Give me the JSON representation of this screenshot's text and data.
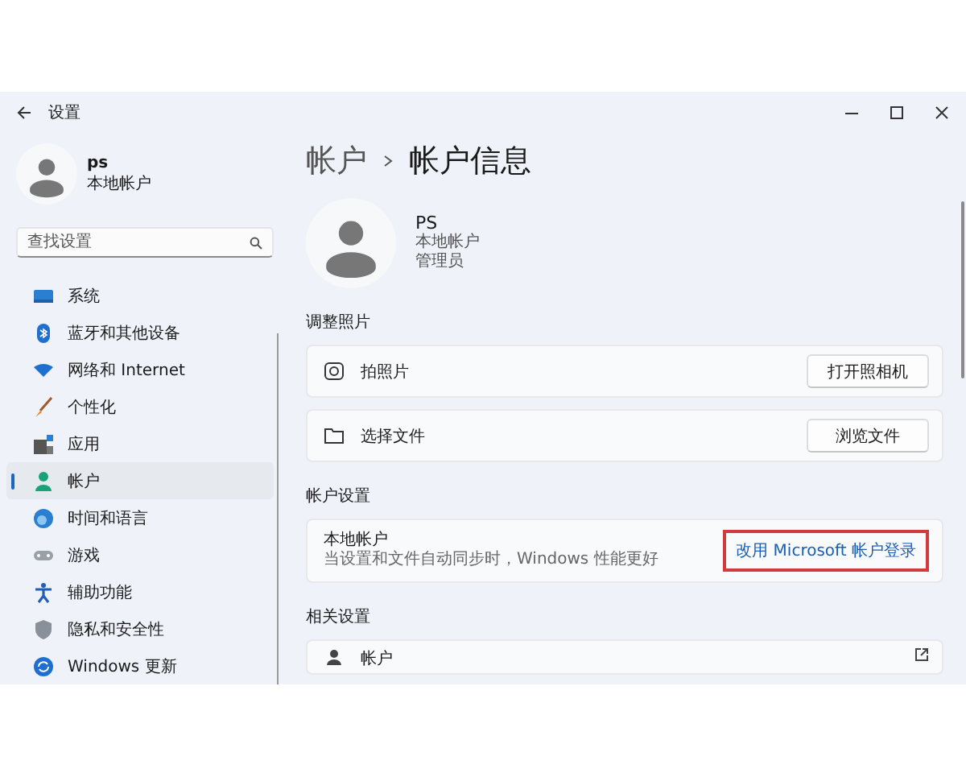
{
  "window": {
    "title": "设置"
  },
  "profile": {
    "name": "ps",
    "subtitle": "本地帐户"
  },
  "search": {
    "placeholder": "查找设置"
  },
  "nav": [
    {
      "label": "系统",
      "selected": false
    },
    {
      "label": "蓝牙和其他设备",
      "selected": false
    },
    {
      "label": "网络和 Internet",
      "selected": false
    },
    {
      "label": "个性化",
      "selected": false
    },
    {
      "label": "应用",
      "selected": false
    },
    {
      "label": "帐户",
      "selected": true
    },
    {
      "label": "时间和语言",
      "selected": false
    },
    {
      "label": "游戏",
      "selected": false
    },
    {
      "label": "辅助功能",
      "selected": false
    },
    {
      "label": "隐私和安全性",
      "selected": false
    },
    {
      "label": "Windows 更新",
      "selected": false
    }
  ],
  "breadcrumb": {
    "parent": "帐户",
    "current": "帐户信息"
  },
  "account": {
    "name": "PS",
    "details": [
      "本地帐户",
      "管理员"
    ]
  },
  "sections": [
    {
      "title": "调整照片",
      "cards": [
        {
          "kind": "button",
          "label": "拍照片",
          "action": "打开照相机"
        },
        {
          "kind": "button",
          "label": "选择文件",
          "action": "浏览文件"
        }
      ]
    },
    {
      "title": "帐户设置",
      "cards": [
        {
          "kind": "link",
          "label": "本地帐户",
          "description": "当设置和文件自动同步时，Windows 性能更好",
          "action": "改用 Microsoft 帐户登录",
          "highlighted": true
        }
      ]
    },
    {
      "title": "相关设置",
      "cards": [
        {
          "kind": "external",
          "label": "帐户"
        }
      ]
    }
  ]
}
